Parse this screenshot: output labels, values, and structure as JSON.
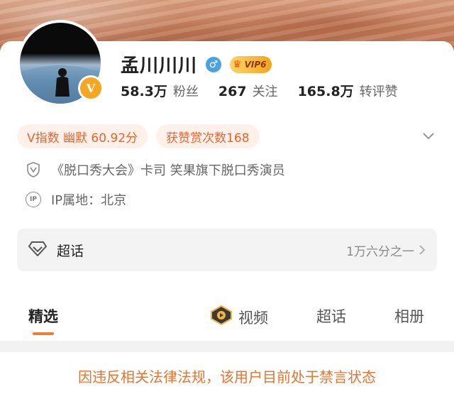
{
  "profile": {
    "name": "孟川川川",
    "gender_symbol": "♂",
    "vip_label": "VIP6",
    "verify_badge": "V"
  },
  "stats": [
    {
      "num": "58.3万",
      "label": "粉丝"
    },
    {
      "num": "267",
      "label": "关注"
    },
    {
      "num": "165.8万",
      "label": "转评赞"
    }
  ],
  "tags": {
    "v_index": "V指数 幽默 60.92分",
    "likes": "获赞赏次数168"
  },
  "info": {
    "bio": "《脱口秀大会》卡司  笑果旗下脱口秀演员",
    "ip": "IP属地：北京",
    "ip_icon_text": "IP"
  },
  "super_topic": {
    "label": "超话",
    "value": "1万六分之一"
  },
  "tabs": {
    "featured": "精选",
    "video": "视频",
    "super": "超话",
    "album": "相册"
  },
  "notice": "因违反相关法律法规，该用户目前处于禁言状态",
  "colors": {
    "accent": "#e8642e",
    "tag_bg": "#fff1ea",
    "vip_gold": "#f6a21c"
  }
}
